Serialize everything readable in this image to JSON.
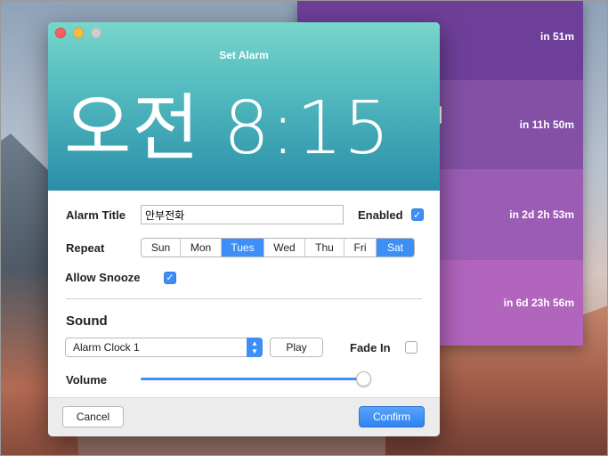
{
  "list": {
    "rows": [
      {
        "label": "in 51m"
      },
      {
        "label": "in 11h 50m"
      },
      {
        "label": "in 2d 2h 53m"
      },
      {
        "label": "in 6d 23h 56m"
      }
    ]
  },
  "dialog": {
    "title": "Set Alarm",
    "time_period": "오전",
    "time_value": "8:15",
    "alarm_title_label": "Alarm Title",
    "alarm_title_value": "안부전화",
    "enabled_label": "Enabled",
    "enabled_checked": true,
    "repeat_label": "Repeat",
    "days": [
      {
        "label": "Sun",
        "selected": false
      },
      {
        "label": "Mon",
        "selected": false
      },
      {
        "label": "Tues",
        "selected": true
      },
      {
        "label": "Wed",
        "selected": false
      },
      {
        "label": "Thu",
        "selected": false
      },
      {
        "label": "Fri",
        "selected": false
      },
      {
        "label": "Sat",
        "selected": true
      }
    ],
    "allow_snooze_label": "Allow Snooze",
    "allow_snooze_checked": true,
    "sound_heading": "Sound",
    "sound_selected": "Alarm Clock 1",
    "play_label": "Play",
    "fade_in_label": "Fade In",
    "fade_in_checked": false,
    "volume_label": "Volume",
    "volume_level": 0.98,
    "cancel_label": "Cancel",
    "confirm_label": "Confirm"
  },
  "colors": {
    "accent": "#3d8ef6",
    "header_top": "#78d6cb",
    "header_bottom": "#2a8ea8"
  }
}
